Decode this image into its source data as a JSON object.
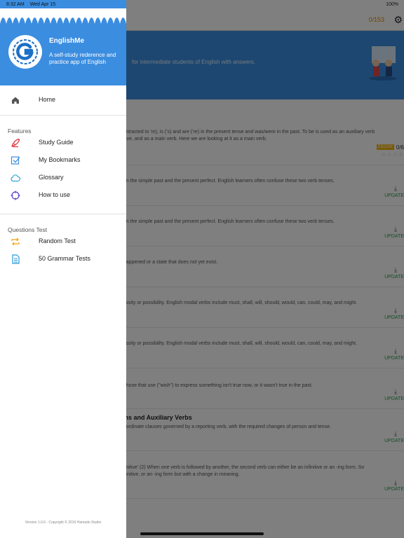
{
  "status_bar": {
    "time": "8:32 AM",
    "date": "Wed Apr 15",
    "battery": "100%"
  },
  "drawer": {
    "app_name": "EnglishMe",
    "app_description": "A self-study rederence and practice app of English",
    "home": {
      "label": "Home",
      "icon": "home-icon"
    },
    "features": {
      "title": "Features",
      "items": [
        {
          "label": "Study Guide",
          "icon": "pen-icon",
          "color": "#e0303a"
        },
        {
          "label": "My Bookmarks",
          "icon": "checkbox-icon",
          "color": "#3b8de0"
        },
        {
          "label": "Glossary",
          "icon": "cloud-icon",
          "color": "#2aa8d8"
        },
        {
          "label": "How to use",
          "icon": "crosshair-icon",
          "color": "#5b3fc8"
        }
      ]
    },
    "questions_test": {
      "title": "Questions Test",
      "items": [
        {
          "label": "Random Test",
          "icon": "shuffle-icon",
          "color": "#f2a000"
        },
        {
          "label": "50 Grammar Tests",
          "icon": "document-icon",
          "color": "#2a9ad8"
        }
      ]
    },
    "version": "Version 1.0.6 - Copyright © 2016 Hamado Studio"
  },
  "background": {
    "progress": "0/153",
    "banner_subtitle": "for intermediate students of English with answers.",
    "rows": [
      {
        "title": "",
        "desc": [
          "contracted to 'm), is ('s) and are ('re) in the present tense and was/were in the past. To be is used as an auxiliary verb",
          "ssive, and as a main verb. Here we are looking at it as a main verb."
        ],
        "badge": "EBOOK",
        "badge_value": "0/6",
        "stars": "☆☆☆☆",
        "action": ""
      },
      {
        "title": "",
        "desc": [
          "een the simple past and the present perfect. English learners often confuse these two verb tenses."
        ],
        "action": "UPDATE"
      },
      {
        "title": "",
        "desc": [
          "een the simple past and the present perfect. English learners often confuse these two verb tenses."
        ],
        "action": "UPDATE"
      },
      {
        "title": "",
        "desc": [
          "t happened or a state that does not yet exist."
        ],
        "action": "UPDATE"
      },
      {
        "title": "",
        "desc": [
          "cessity or possibility. English modal verbs include must, shall, will, should, would, can, could, may, and might."
        ],
        "action": "UPDATE"
      },
      {
        "title": "",
        "desc": [
          "cessity or possibility. English modal verbs include must, shall, will, should, would, can, could, may, and might."
        ],
        "action": "UPDATE"
      },
      {
        "title": "",
        "desc": [
          "e those that use (\"wish\") to express something isn't true now, or it wasn't true in the past."
        ],
        "action": "UPDATE"
      },
      {
        "title": "ons and Auxiliary Verbs",
        "desc": [
          "ubordinate clauses governed by a reporting verb, with the required changes of person and tense."
        ],
        "action": "UPDATE"
      },
      {
        "title": "",
        "desc": [
          "nfinitive' (2) When one verb is followed by another, the second verb can either be an infinitive or an -ing form. So",
          "infinitive, or an -ing form but with a change in meaning."
        ],
        "action": "UPDATE"
      }
    ]
  }
}
